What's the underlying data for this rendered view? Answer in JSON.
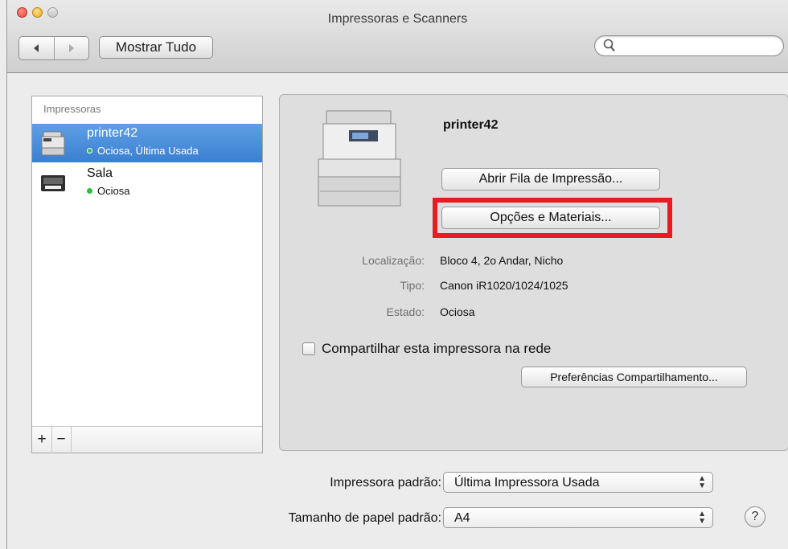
{
  "window": {
    "title": "Impressoras e Scanners"
  },
  "toolbar": {
    "back_icon": "back-arrow-icon",
    "forward_icon": "forward-arrow-icon",
    "show_all_label": "Mostrar Tudo",
    "search_placeholder": "",
    "search_icon": "search-icon"
  },
  "sidebar": {
    "heading": "Impressoras",
    "printers": [
      {
        "name": "printer42",
        "status": "Ociosa, Última Usada",
        "selected": true,
        "icon": "printer-mfp-icon"
      },
      {
        "name": "Sala",
        "status": "Ociosa",
        "selected": false,
        "icon": "printer-laser-icon"
      }
    ],
    "add_label": "+",
    "remove_label": "−"
  },
  "detail": {
    "name": "printer42",
    "open_queue_label": "Abrir Fila de Impressão...",
    "options_label": "Opções e Materiais...",
    "info": [
      {
        "label": "Localização:",
        "value": "Bloco 4, 2o Andar, Nicho"
      },
      {
        "label": "Tipo:",
        "value": "Canon iR1020/1024/1025"
      },
      {
        "label": "Estado:",
        "value": "Ociosa"
      }
    ],
    "share_label": "Compartilhar esta impressora na rede",
    "share_checked": false,
    "sharing_prefs_label": "Preferências Compartilhamento..."
  },
  "footer": {
    "default_printer_label": "Impressora padrão:",
    "default_printer_value": "Última Impressora Usada",
    "paper_size_label": "Tamanho de papel padrão:",
    "paper_size_value": "A4",
    "help_label": "?"
  },
  "colors": {
    "selection": "#3a7fd1",
    "highlight_border": "#e51d23",
    "status_idle": "#2cbf47"
  }
}
